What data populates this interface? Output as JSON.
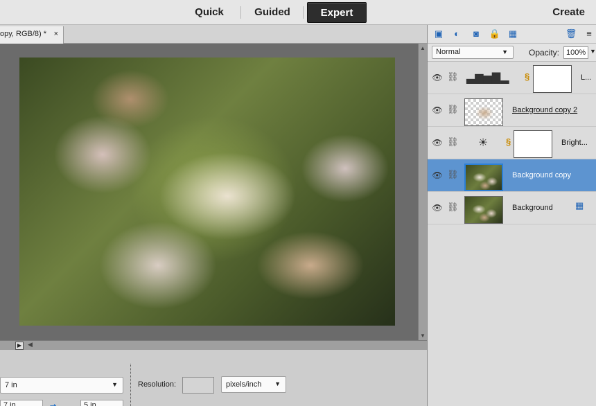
{
  "modes": {
    "tabs": [
      {
        "label": "Quick"
      },
      {
        "label": "Guided"
      },
      {
        "label": "Expert",
        "active": true
      }
    ],
    "create_label": "Create"
  },
  "document": {
    "tab_label": "opy, RGB/8) *",
    "close_glyph": "×"
  },
  "options_bar": {
    "width_value": "7 in",
    "resolution_label": "Resolution:",
    "resolution_value": "",
    "resolution_unit": "pixels/inch",
    "height_value": "7 in",
    "swap_icon": "swap-arrows-icon",
    "second_value": "5 in"
  },
  "layers_panel": {
    "toolbar_icons": [
      "new-layer-icon",
      "adjustment-layer-icon",
      "add-mask-icon",
      "lock-icon",
      "lock-all-icon",
      "trash-icon",
      "panel-menu-icon"
    ],
    "blend_mode": "Normal",
    "opacity_label": "Opacity:",
    "opacity_value": "100%",
    "layers": [
      {
        "name": "L...",
        "type": "levels-adjustment",
        "has_mask": true
      },
      {
        "name": "Background copy 2",
        "type": "pixel"
      },
      {
        "name": "Bright...",
        "type": "brightness-adjustment",
        "has_mask": true
      },
      {
        "name": "Background copy",
        "type": "pixel",
        "selected": true
      },
      {
        "name": "Background",
        "type": "pixel",
        "locked": true
      }
    ]
  },
  "colors": {
    "accent": "#1f63b5",
    "selected_layer": "#5d94d0",
    "active_mode": "#2d2d2d",
    "canvas_bg": "#6b6b6b"
  }
}
